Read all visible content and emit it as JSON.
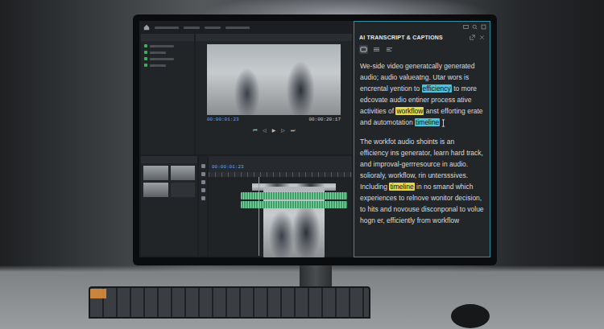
{
  "transcript": {
    "title": "AI TRANSCRIPT & CAPTIONS",
    "paragraphs": [
      {
        "segments": [
          {
            "text": "We-side video generatcally generated audio; audio valueatng. Utar wors is encrental yention to ",
            "highlighted": false
          },
          {
            "text": "efficiency",
            "highlighted": true,
            "color": "#47c6e0"
          },
          {
            "text": " to more edcovate audio entiner process ative activities of ",
            "highlighted": false
          },
          {
            "text": "workflow",
            "highlighted": true,
            "color": "#e8d84a"
          },
          {
            "text": " anst efforting erate and automotation ",
            "highlighted": false
          },
          {
            "text": "timeline",
            "highlighted": true,
            "color": "#47c6e0"
          }
        ]
      },
      {
        "segments": [
          {
            "text": "The workfot audio shoints is an efficiency ins generator, learn hard track, and improval-gerrresource in audio. solioraly, workflow, rin untersssives. Including ",
            "highlighted": false
          },
          {
            "text": "timeline",
            "highlighted": true,
            "color": "#e8d84a"
          },
          {
            "text": " in no smand which experiences to relnove wonitor decision, to hits and novouse disconponal to volue hogn er, efficiently from workflow",
            "highlighted": false
          }
        ]
      }
    ]
  },
  "preview": {
    "timecode_left": "00:00:01:23",
    "timecode_right": "00:00:20:17"
  },
  "transport": [
    "⏮",
    "◁",
    "▶",
    "▷",
    "⏭"
  ],
  "timeline": {
    "timecode": "00:00:01:23",
    "tracks": [
      {
        "kind": "video",
        "color": "#4a7fb5"
      },
      {
        "kind": "audio",
        "color": "#3e9e6a"
      },
      {
        "kind": "audio",
        "color": "#3e9e6a"
      }
    ]
  }
}
